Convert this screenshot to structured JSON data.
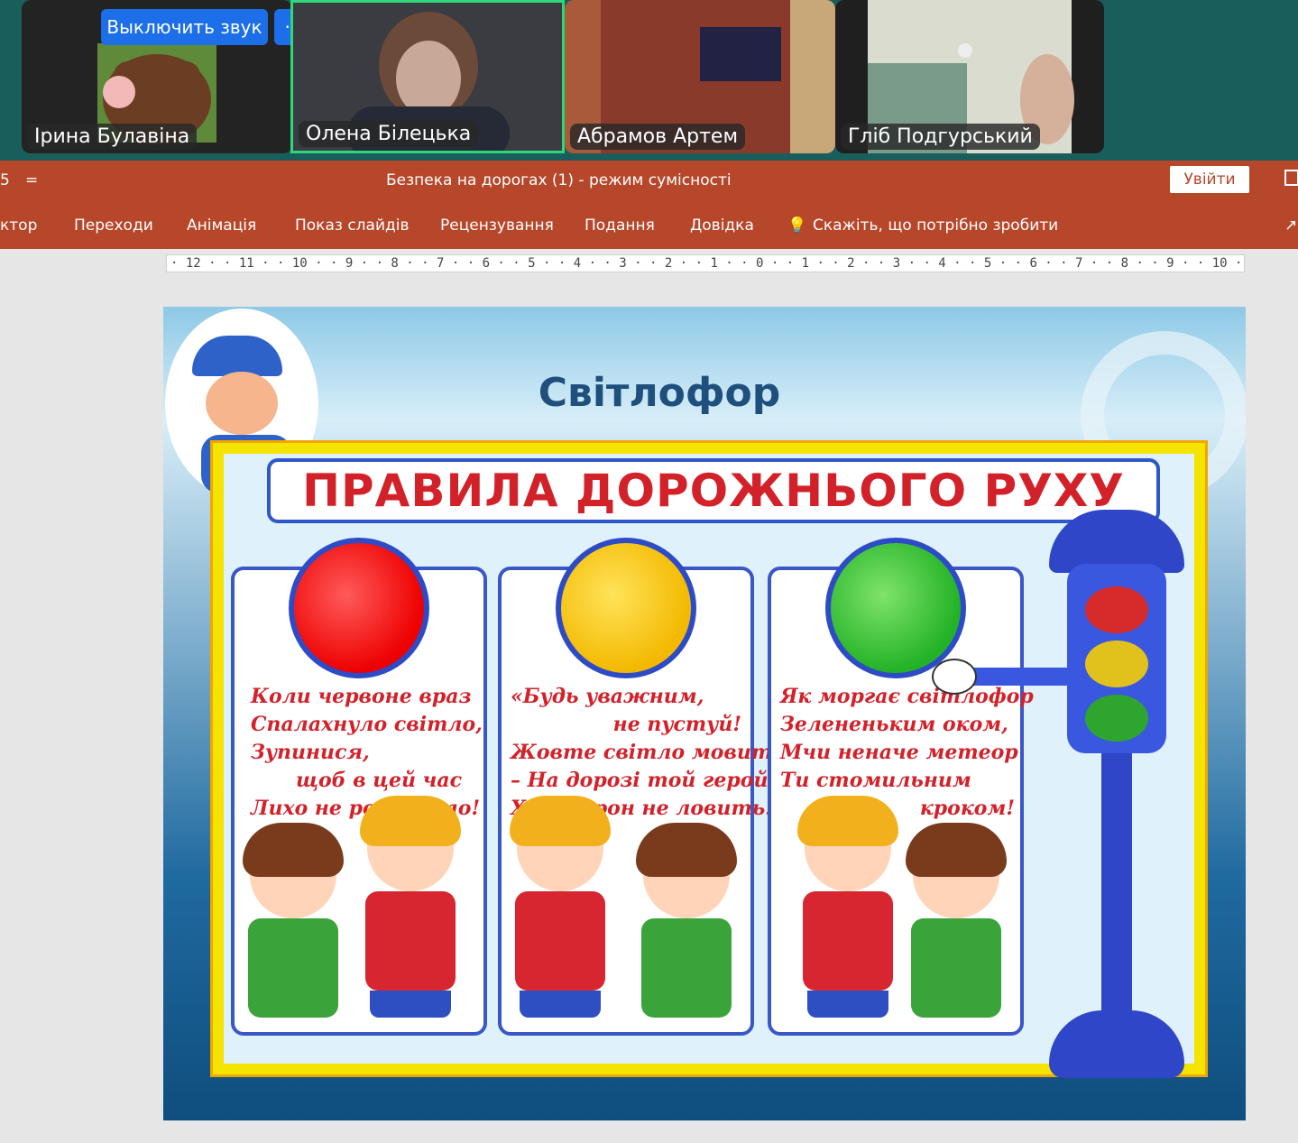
{
  "meeting": {
    "mute_button_label": "Выключить звук",
    "more_button_label": "···",
    "participants": [
      {
        "name": "Ірина Булавіна"
      },
      {
        "name": "Олена Білецька"
      },
      {
        "name": "Абрамов Артем"
      },
      {
        "name": "Гліб Подгурський"
      }
    ]
  },
  "powerpoint": {
    "quick_access": "5",
    "quick_access_more": "=",
    "document_title": "Безпека на дорогах (1)  -  режим сумісності",
    "signin_label": "Увійти",
    "tabs": [
      {
        "label": "ктор"
      },
      {
        "label": "Переходи"
      },
      {
        "label": "Анімація"
      },
      {
        "label": "Показ слайдів"
      },
      {
        "label": "Рецензування"
      },
      {
        "label": "Подання"
      },
      {
        "label": "Довідка"
      },
      {
        "label": "Скажіть, що потрібно зробити"
      }
    ],
    "ruler": "· 12 · · 11 · · 10 · · 9 · · 8 · · 7 · · 6 · · 5 · · 4 · · 3 · · 2 · · 1 · · 0 · · 1 · · 2 · · 3 · · 4 · · 5 · · 6 · · 7 · · 8 · · 9 · · 10 · · 11 · · 12 ·"
  },
  "slide": {
    "title": "Світлофор",
    "banner": "ПРАВИЛА ДОРОЖНЬОГО РУХУ",
    "panels": [
      {
        "light": "red",
        "lines": [
          "Коли червоне враз",
          "Спалахнуло світло,",
          "Зупинися,",
          "щоб в цей час",
          "Лихо не розквітло!"
        ]
      },
      {
        "light": "yellow",
        "lines": [
          "«Будь уважним,",
          "не пустуй!",
          "Жовте світло мовить.",
          "– На дорозі той герой,",
          "Хто ворон не ловить!»"
        ]
      },
      {
        "light": "green",
        "lines": [
          "Як моргає світлофор",
          "Зелененьким оком,",
          "Мчи неначе метеор",
          "Ти стомильним",
          "кроком!"
        ]
      }
    ],
    "colors": {
      "ribbon": "#b7472a",
      "teams_accent": "#1c6fe8",
      "active_speaker": "#2fd67a"
    }
  }
}
